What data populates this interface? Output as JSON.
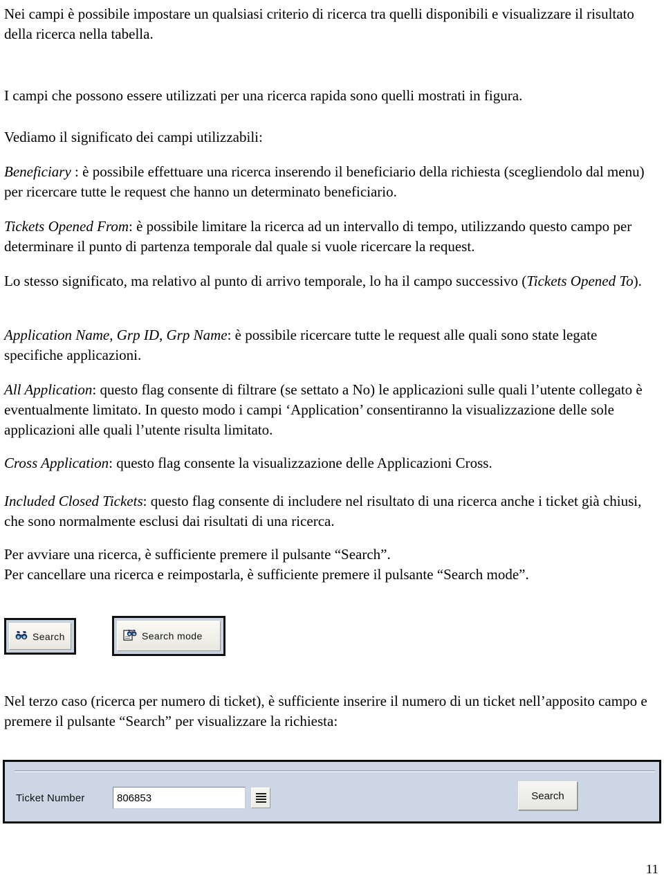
{
  "document": {
    "language": "it",
    "page_number": "11",
    "paragraphs": [
      {
        "id": "p1",
        "runs": [
          {
            "style": "normal",
            "text": "Nei campi è possibile impostare un qualsiasi criterio di ricerca tra quelli disponibili e visualizzare il risultato della ricerca nella tabella."
          }
        ]
      },
      {
        "id": "p2",
        "runs": [
          {
            "style": "normal",
            "text": "I campi che possono essere utilizzati per una ricerca rapida sono quelli mostrati in figura."
          }
        ]
      },
      {
        "id": "p3",
        "runs": [
          {
            "style": "normal",
            "text": "Vediamo il significato dei campi utilizzabili:"
          }
        ]
      },
      {
        "id": "p4",
        "runs": [
          {
            "style": "italic",
            "text": "Beneficiary"
          },
          {
            "style": "normal",
            "text": " : è possibile effettuare una ricerca inserendo il beneficiario della richiesta (scegliendolo dal menu) per ricercare tutte le request che hanno un determinato beneficiario."
          }
        ]
      },
      {
        "id": "p5",
        "runs": [
          {
            "style": "italic",
            "text": "Tickets Opened From"
          },
          {
            "style": "normal",
            "text": ": è possibile limitare la ricerca ad un intervallo di tempo, utilizzando questo campo per determinare il punto di partenza temporale dal quale si vuole ricercare la request."
          }
        ]
      },
      {
        "id": "p6",
        "runs": [
          {
            "style": "normal",
            "text": "Lo stesso significato, ma relativo al punto di arrivo temporale, lo ha il campo successivo ("
          },
          {
            "style": "italic",
            "text": "Tickets Opened To"
          },
          {
            "style": "normal",
            "text": ")."
          }
        ]
      },
      {
        "id": "p7",
        "runs": [
          {
            "style": "italic",
            "text": "Application Name"
          },
          {
            "style": "normal",
            "text": ", "
          },
          {
            "style": "italic",
            "text": "Grp ID"
          },
          {
            "style": "normal",
            "text": ", "
          },
          {
            "style": "italic",
            "text": "Grp Name"
          },
          {
            "style": "normal",
            "text": ": è possibile ricercare tutte le request alle quali sono state legate specifiche applicazioni."
          }
        ]
      },
      {
        "id": "p8",
        "runs": [
          {
            "style": "italic",
            "text": "All Application"
          },
          {
            "style": "normal",
            "text": ": questo flag consente di filtrare (se settato a No) le applicazioni sulle quali l’utente collegato è eventualmente limitato. In questo modo i campi ‘Application’ consentiranno la visualizzazione delle sole applicazioni alle quali l’utente risulta limitato."
          }
        ]
      },
      {
        "id": "p9",
        "runs": [
          {
            "style": "italic",
            "text": "Cross Application"
          },
          {
            "style": "normal",
            "text": ": questo flag consente la visualizzazione delle Applicazioni Cross."
          }
        ]
      },
      {
        "id": "p10",
        "runs": [
          {
            "style": "italic",
            "text": "Included Closed Tickets"
          },
          {
            "style": "normal",
            "text": ": questo flag consente di includere nel risultato di una ricerca anche i ticket già chiusi, che sono normalmente esclusi dai risultati di una ricerca."
          }
        ]
      },
      {
        "id": "p11",
        "runs": [
          {
            "style": "normal",
            "text": "Per avviare una ricerca, è sufficiente premere il pulsante “Search”."
          },
          {
            "style": "break",
            "text": ""
          },
          {
            "style": "normal",
            "text": "Per cancellare una ricerca e reimpostarla, è sufficiente premere il pulsante “Search mode”."
          }
        ]
      },
      {
        "id": "p12",
        "runs": [
          {
            "style": "normal",
            "text": "Nel terzo caso (ricerca per numero di ticket), è sufficiente inserire il numero di un ticket nell’apposito campo e premere il pulsante “Search” per visualizzare la richiesta:"
          }
        ]
      }
    ]
  },
  "figure_buttons": {
    "search_button": {
      "label": "Search",
      "icon": "binoculars-icon"
    },
    "search_mode_button": {
      "label": "Search mode",
      "icon": "binoculars-document-icon"
    },
    "frame_color": "#c9d3e0",
    "border_color": "#111111"
  },
  "figure_ticket_form": {
    "ticket_number_label": "Ticket Number",
    "ticket_number_value": "806853",
    "ticket_number_placeholder": "",
    "menu_button_icon": "hamburger-menu-icon",
    "search_button_label": "Search",
    "panel_color": "#ccd6e4",
    "border_color": "#0d0d0d"
  }
}
